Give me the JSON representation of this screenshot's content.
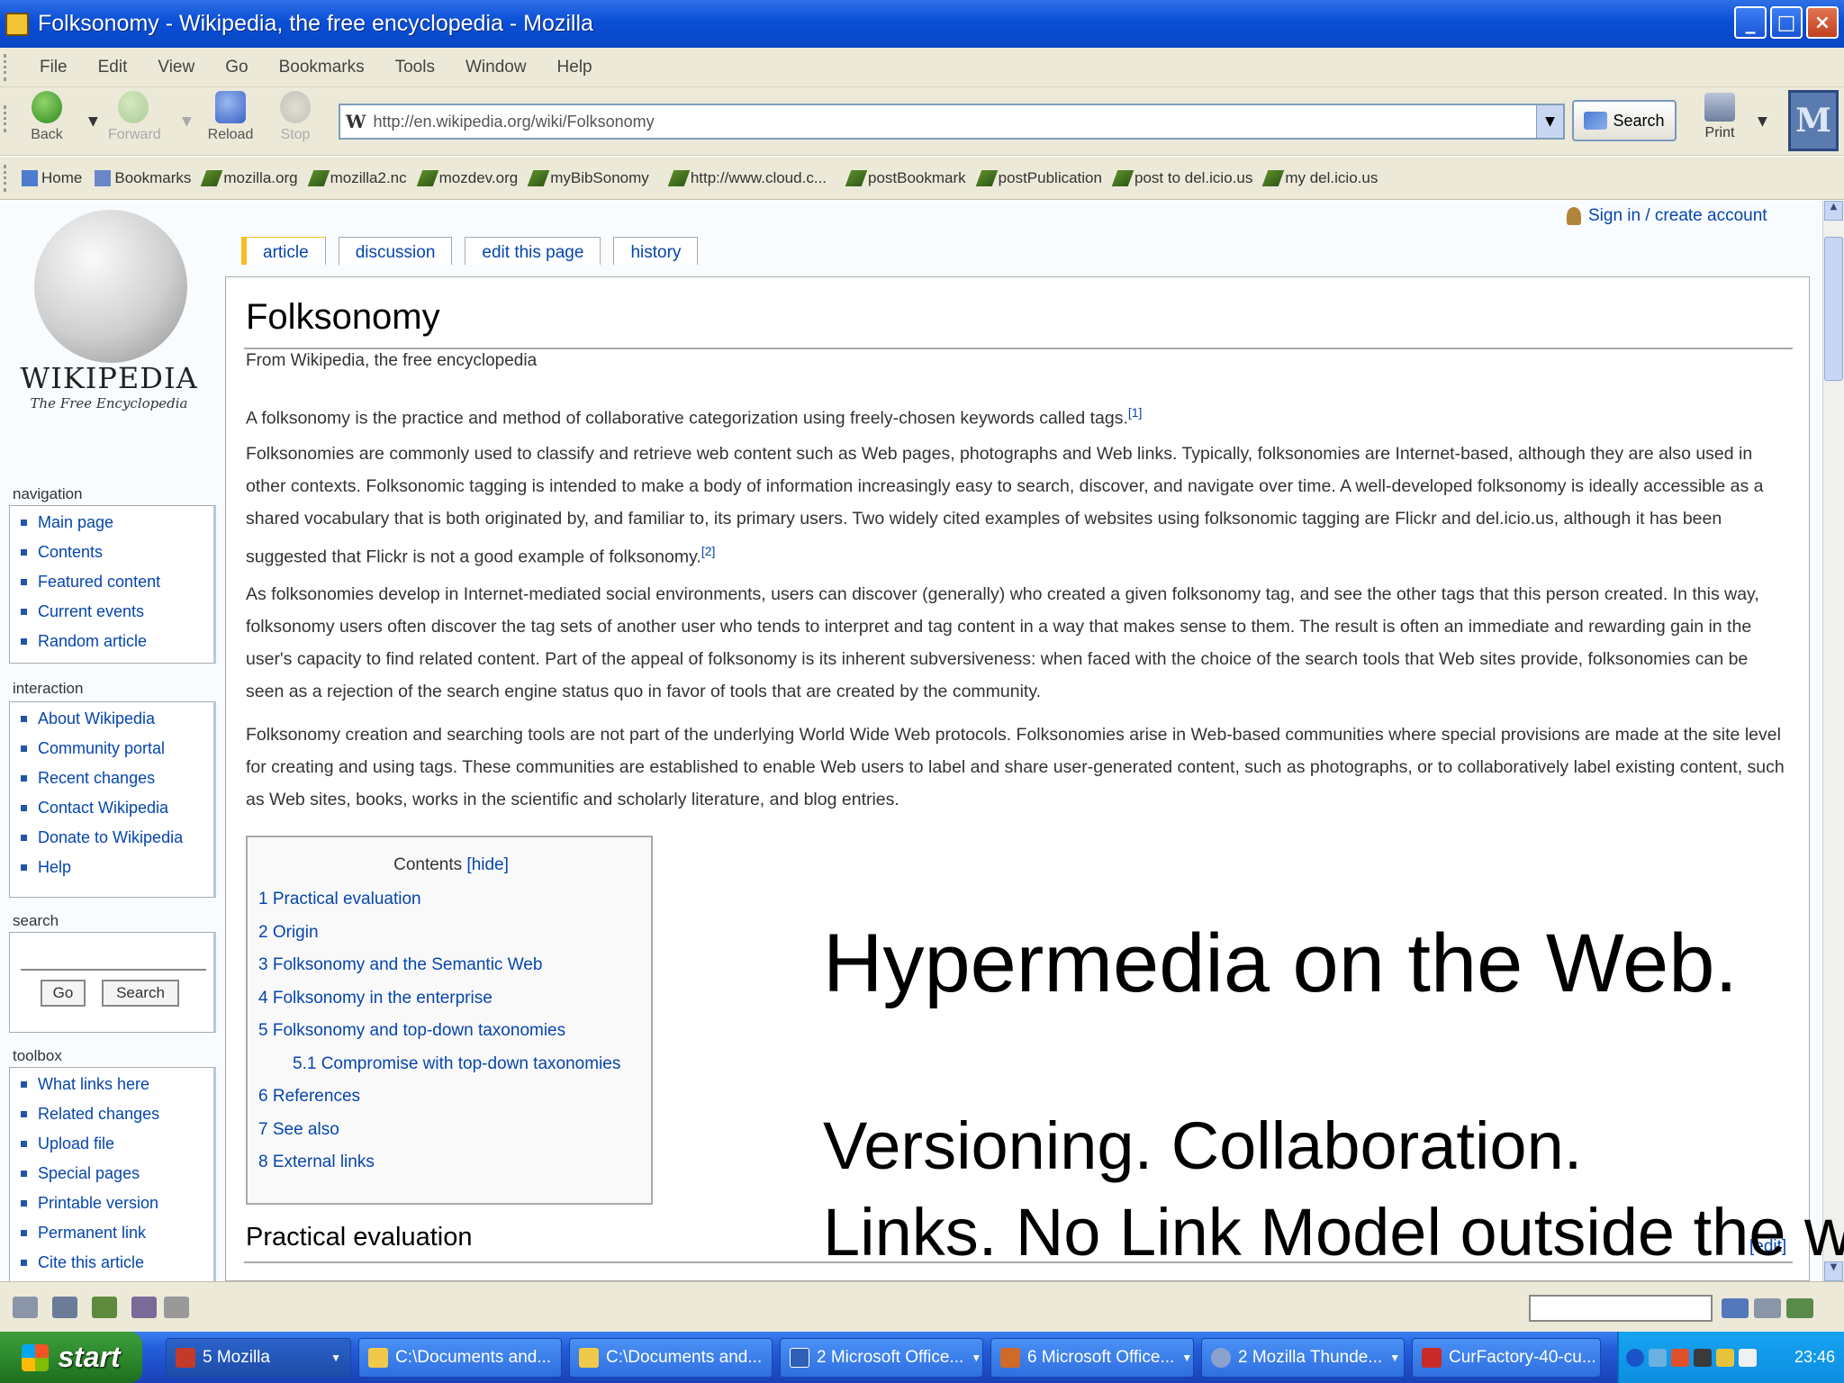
{
  "window": {
    "title": "Folksonomy - Wikipedia, the free encyclopedia - Mozilla",
    "buttons": {
      "minimize": "_",
      "maximize": "□",
      "close": "×"
    }
  },
  "menu": [
    "File",
    "Edit",
    "View",
    "Go",
    "Bookmarks",
    "Tools",
    "Window",
    "Help"
  ],
  "toolbar": {
    "back": "Back",
    "forward": "Forward",
    "reload": "Reload",
    "stop": "Stop",
    "url": "http://en.wikipedia.org/wiki/Folksonomy",
    "search": "Search",
    "print": "Print",
    "throbber": "M"
  },
  "bookmarks": [
    "Home",
    "Bookmarks",
    "mozilla.org",
    "mozilla2.nc",
    "mozdev.org",
    "myBibSonomy",
    "http://www.cloud.c...",
    "postBookmark",
    "postPublication",
    "post to del.icio.us",
    "my del.icio.us"
  ],
  "wiki": {
    "logo_word": "WIKIPEDIA",
    "logo_tagline": "The Free Encyclopedia",
    "signin": "Sign in / create account",
    "tabs": [
      "article",
      "discussion",
      "edit this page",
      "history"
    ],
    "nav_heading": "navigation",
    "nav": [
      "Main page",
      "Contents",
      "Featured content",
      "Current events",
      "Random article"
    ],
    "interaction_heading": "interaction",
    "interaction": [
      "About Wikipedia",
      "Community portal",
      "Recent changes",
      "Contact Wikipedia",
      "Donate to Wikipedia",
      "Help"
    ],
    "search_heading": "search",
    "go": "Go",
    "search_btn": "Search",
    "toolbox_heading": "toolbox",
    "toolbox": [
      "What links here",
      "Related changes",
      "Upload file",
      "Special pages",
      "Printable version",
      "Permanent link",
      "Cite this article"
    ]
  },
  "article": {
    "title": "Folksonomy",
    "subtitle": "From Wikipedia, the free encyclopedia",
    "p1": "A folksonomy is the practice and method of collaborative categorization using freely-chosen keywords called tags.",
    "p1_ref": "[1]",
    "p2": "Folksonomies are commonly used to classify and retrieve web content such as Web pages, photographs and Web links. Typically, folksonomies are Internet-based, although they are also used in other contexts. Folksonomic tagging is intended to make a body of information increasingly easy to search, discover, and navigate over time. A well-developed folksonomy is ideally accessible as a shared vocabulary that is both originated by, and familiar to, its primary users. Two widely cited examples of websites using folksonomic tagging are Flickr and del.icio.us, although it has been suggested that Flickr is not a good example of folksonomy.",
    "p2_ref": "[2]",
    "p3": "As folksonomies develop in Internet-mediated social environments, users can discover (generally) who created a given folksonomy tag, and see the other tags that this person created. In this way, folksonomy users often discover the tag sets of another user who tends to interpret and tag content in a way that makes sense to them. The result is often an immediate and rewarding gain in the user's capacity to find related content. Part of the appeal of folksonomy is its inherent subversiveness: when faced with the choice of the search tools that Web sites provide, folksonomies can be seen as a rejection of the search engine status quo in favor of tools that are created by the community.",
    "p4": "Folksonomy creation and searching tools are not part of the underlying World Wide Web protocols. Folksonomies arise in Web-based communities where special provisions are made at the site level for creating and using tags. These communities are established to enable Web users to label and share user-generated content, such as photographs, or to collaboratively label existing content, such as Web sites, books, works in the scientific and scholarly literature, and blog entries.",
    "toc_title": "Contents",
    "toc_hide": "[hide]",
    "toc": [
      "1 Practical evaluation",
      "2 Origin",
      "3 Folksonomy and the Semantic Web",
      "4 Folksonomy in the enterprise",
      "5 Folksonomy and top-down taxonomies",
      "5.1 Compromise with top-down taxonomies",
      "6 References",
      "7 See also",
      "8 External links"
    ],
    "section": "Practical evaluation",
    "edit": "[edit]"
  },
  "overlay": {
    "heading": "Hypermedia on the Web.",
    "line1": "Versioning.  Collaboration.",
    "line2": "Links. No Link Model outside the wiki."
  },
  "taskbar": {
    "start": "start",
    "tasks": [
      "5 Mozilla",
      "C:\\Documents and...",
      "C:\\Documents and...",
      "2 Microsoft Office...",
      "6 Microsoft Office...",
      "2 Mozilla Thunde...",
      "CurFactory-40-cu..."
    ],
    "clock": "23:46"
  },
  "colors": {
    "title_bar": "#0a4fd6",
    "taskbar": "#245edb",
    "start": "#2d8a2d",
    "link": "#0645ad",
    "chrome": "#ece9d8"
  }
}
